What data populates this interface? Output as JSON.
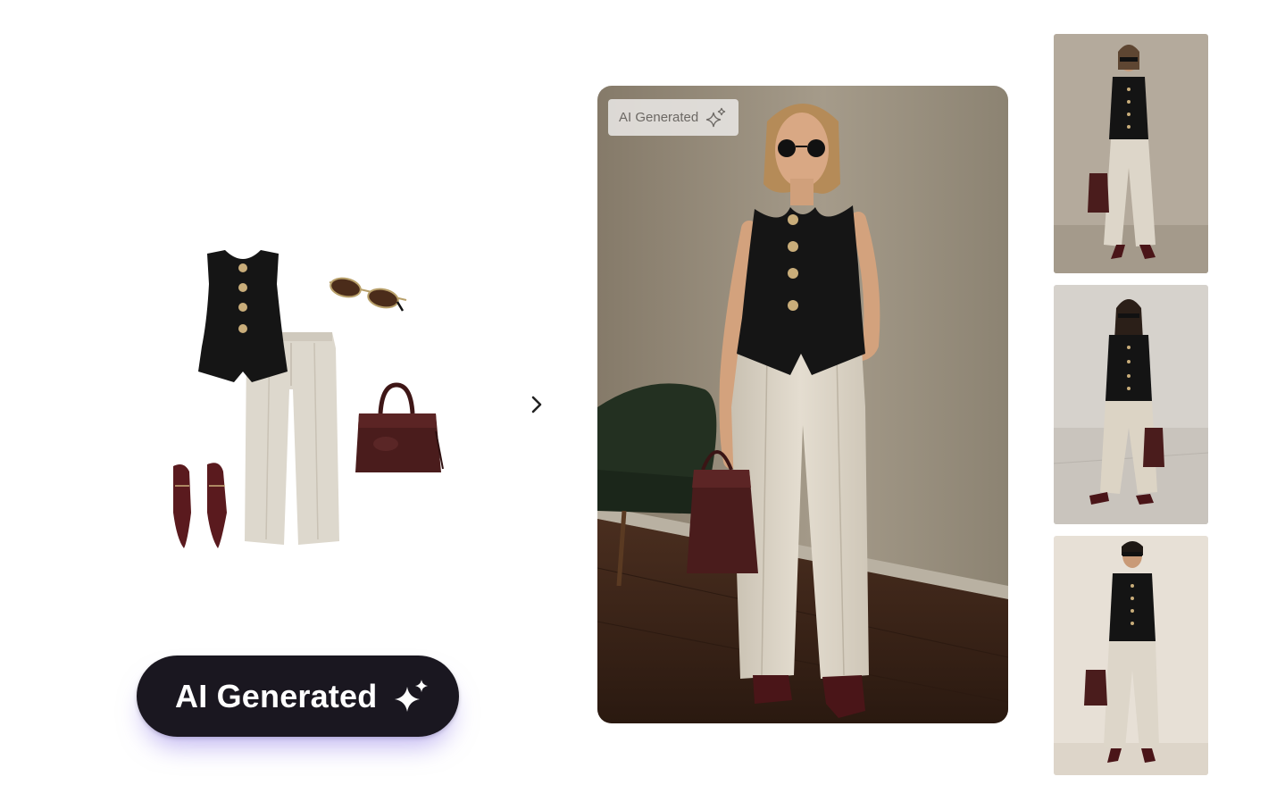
{
  "generated_badge": {
    "label": "AI Generated",
    "icon": "sparkle-icon"
  },
  "generate_pill": {
    "label": "AI Generated",
    "icon": "sparkle-icon"
  },
  "next_arrow": {
    "icon": "chevron-right-icon"
  },
  "colors": {
    "pill_bg": "#1a1720",
    "pill_glow": "#8c78e6",
    "vest": "#141414",
    "pants": "#ddd7cb",
    "bag": "#4a1c1c",
    "wall": "#8f8574",
    "floor": "#3a2418"
  },
  "outfit_items": [
    "black-vest",
    "cream-trousers",
    "sunglasses",
    "burgundy-handbag",
    "burgundy-slingback-flats"
  ],
  "thumbnails": [
    "model-variant-1",
    "model-variant-2",
    "model-variant-3"
  ]
}
